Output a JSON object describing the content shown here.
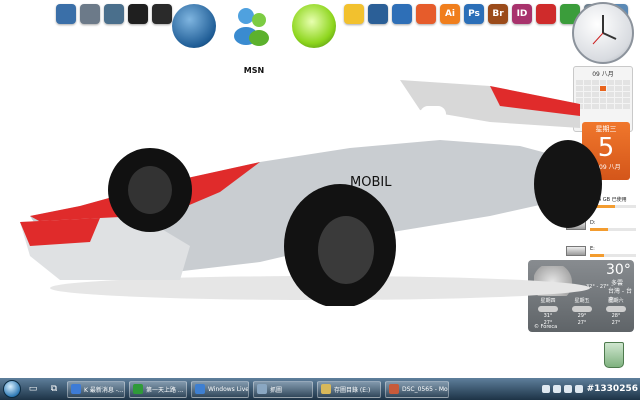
{
  "desktop": {
    "dock_icons": [
      {
        "name": "windows-orb-icon",
        "color": "#3a6fa8",
        "label": ""
      },
      {
        "name": "tools-icon",
        "color": "#6c7a89",
        "label": ""
      },
      {
        "name": "calculator-icon",
        "color": "#4a6f8c",
        "label": ""
      },
      {
        "name": "magnifier-icon",
        "color": "#1f1f1f",
        "label": ""
      },
      {
        "name": "stack-icon",
        "color": "#2a2a2a",
        "label": ""
      }
    ],
    "msn_label": "MSN",
    "right_dock": [
      {
        "name": "media-player-icon",
        "color": "#f2c12e",
        "label": ""
      },
      {
        "name": "film-icon",
        "color": "#2b5f97",
        "label": ""
      },
      {
        "name": "play-icon",
        "color": "#2e6fb7",
        "label": ""
      },
      {
        "name": "grid-app-icon",
        "color": "#e65c2b",
        "label": ""
      },
      {
        "name": "illustrator-icon",
        "color": "#f07e1c",
        "label": "Ai"
      },
      {
        "name": "photoshop-icon",
        "color": "#2b6fb8",
        "label": "Ps"
      },
      {
        "name": "bridge-icon",
        "color": "#9b4b1a",
        "label": "Br"
      },
      {
        "name": "indesign-icon",
        "color": "#a8326c",
        "label": "ID"
      },
      {
        "name": "acrobat-icon",
        "color": "#cf2b2b",
        "label": ""
      },
      {
        "name": "globe-icon",
        "color": "#3b9d3b",
        "label": ""
      },
      {
        "name": "burn-icon",
        "color": "#6c7f8f",
        "label": ""
      },
      {
        "name": "folder-icon",
        "color": "#5a89b5",
        "label": ""
      }
    ]
  },
  "calendar": {
    "header": "09 八月"
  },
  "date_card": {
    "weekday": "星期三",
    "day": "5",
    "year_month": "2009 八月"
  },
  "drives": [
    {
      "label": "C:",
      "detail": "14.4 GB 已使用",
      "fill": 0.55
    },
    {
      "label": "D:",
      "detail": "",
      "fill": 0.4
    },
    {
      "label": "E:",
      "detail": "",
      "fill": 0.3
    }
  ],
  "weather": {
    "temp": "30°",
    "desc": "多雲",
    "range": "32° - 27°",
    "location": "台灣 - 台南",
    "forecast": [
      {
        "day": "星期四",
        "hi": "31°",
        "lo": "27°"
      },
      {
        "day": "星期五",
        "hi": "29°",
        "lo": "27°"
      },
      {
        "day": "星期六",
        "hi": "28°",
        "lo": "27°"
      }
    ],
    "brand": "© Foreca"
  },
  "taskbar": {
    "tasks": [
      {
        "label": "K 最新消息 -...",
        "color": "#3d7bd6"
      },
      {
        "label": "第一天上路 ...",
        "color": "#2f9a39"
      },
      {
        "label": "Windows Live...",
        "color": "#3e7fd1"
      },
      {
        "label": "抓圖",
        "color": "#8aa7c2"
      },
      {
        "label": "存圖目錄 (E:)",
        "color": "#d8b85a"
      },
      {
        "label": "DSC_0565 - Mo...",
        "color": "#c75a3a"
      }
    ],
    "tag": "#1330256"
  },
  "colors": {
    "accent": "#e8631c",
    "car_red": "#e02b2b",
    "car_silver": "#c4c8cc"
  }
}
